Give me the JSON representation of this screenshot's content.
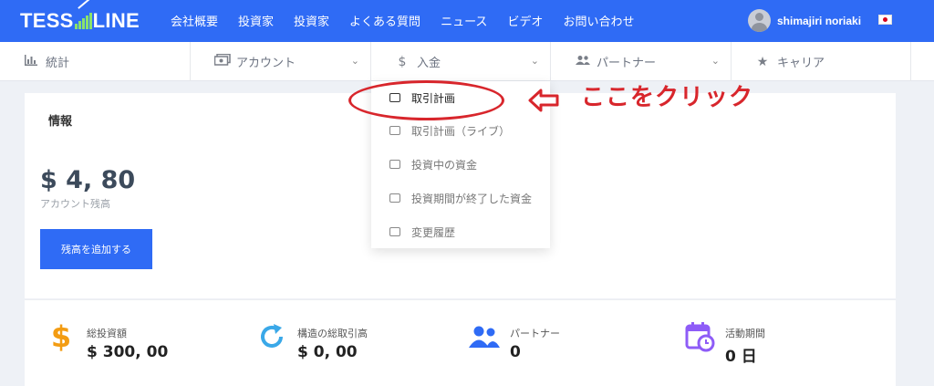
{
  "brand": {
    "logo_left": "TESS",
    "logo_right": "LINE"
  },
  "nav": {
    "items": [
      "会社概要",
      "投資家",
      "投資家",
      "よくある質問",
      "ニュース",
      "ビデオ",
      "お問い合わせ"
    ]
  },
  "user": {
    "name": "shimajiri noriaki"
  },
  "submenu": {
    "items": [
      {
        "label": "統計",
        "icon": "bar-chart-icon"
      },
      {
        "label": "アカウント",
        "icon": "money-icon"
      },
      {
        "label": "入金",
        "icon": "dollar-icon"
      },
      {
        "label": "パートナー",
        "icon": "users-icon"
      },
      {
        "label": "キャリア",
        "icon": "star-icon"
      }
    ]
  },
  "dropdown": {
    "items": [
      "取引計画",
      "取引計画（ライブ）",
      "投資中の資金",
      "投資期間が終了した資金",
      "変更履歴"
    ]
  },
  "annotation": {
    "text": "ここをクリック",
    "color": "#d8262c"
  },
  "info": {
    "title": "情報",
    "balance": "$ 4, 80",
    "balance_label": "アカウント残高",
    "add_button": "残高を追加する"
  },
  "stats": [
    {
      "label": "総投資額",
      "value": "$ 300, 00",
      "color": "#f39c12"
    },
    {
      "label": "構造の総取引高",
      "value": "$ 0, 00",
      "color": "#3aa8e8"
    },
    {
      "label": "パートナー",
      "value": "0",
      "color": "#2f6bf5"
    },
    {
      "label": "活動期間",
      "value": "0 日",
      "color": "#8e5cf7"
    }
  ],
  "colors": {
    "primary": "#2f6bf5",
    "accent_green": "#8be36b"
  }
}
